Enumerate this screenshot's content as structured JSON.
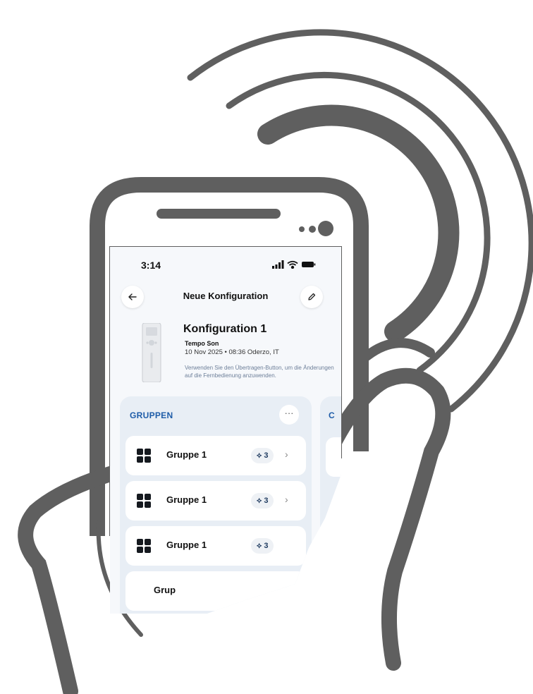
{
  "status_bar": {
    "time": "3:14"
  },
  "nav": {
    "title": "Neue Konfiguration"
  },
  "config": {
    "title": "Konfiguration 1",
    "product": "Tempo Son",
    "date_location": "10 Nov 2025 • 08:36  Oderzo, IT",
    "hint": "Verwenden Sie den Übertragen-Button, um die Änderungen auf die Fernbedienung anzuwenden."
  },
  "groups_panel": {
    "title": "GRUPPEN",
    "more_label": "···",
    "items": [
      {
        "label": "Gruppe 1",
        "count": "3"
      },
      {
        "label": "Gruppe 1",
        "count": "3"
      },
      {
        "label": "Gruppe 1",
        "count": "3"
      },
      {
        "label": "Grup",
        "count": ""
      }
    ]
  },
  "second_panel": {
    "title_initial": "C"
  },
  "colors": {
    "accent": "#1e5ca8",
    "outline": "#5f5f5f",
    "panel_bg": "#e8eef5",
    "hint_text": "#6d7f99"
  },
  "icons": [
    "back-arrow-icon",
    "edit-pencil-icon",
    "signal-icon",
    "wifi-icon",
    "battery-icon",
    "grid-icon",
    "blinds-icon",
    "chevron-right-icon",
    "more-icon"
  ]
}
